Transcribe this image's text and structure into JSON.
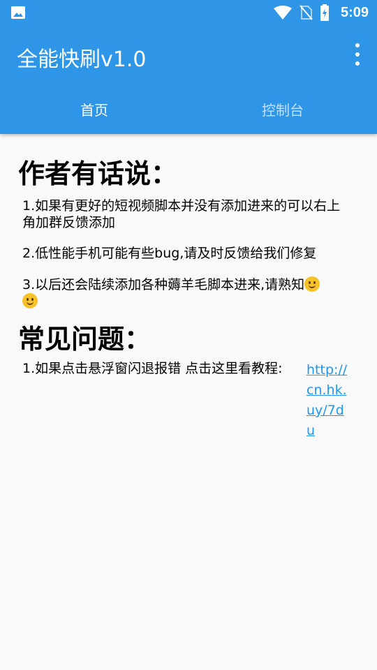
{
  "status_bar": {
    "time": "5:09",
    "left_icon": "image-icon",
    "right_icons": [
      "wifi-icon",
      "no-sim-icon",
      "battery-charging-icon"
    ]
  },
  "toolbar": {
    "title": "全能快刷v1.0",
    "overflow_icon": "more-vert-icon"
  },
  "tabs": [
    {
      "label": "首页",
      "active": true
    },
    {
      "label": "控制台",
      "active": false
    }
  ],
  "home": {
    "author_heading": "作者有话说：",
    "notes": [
      "1.如果有更好的短视频脚本并没有添加进来的可以右上角加群反馈添加",
      "2.低性能手机可能有些bug,请及时反馈给我们修复",
      "3.以后还会陆续添加各种薅羊毛脚本进来,请熟知"
    ],
    "faq_heading": "常见问题：",
    "faq": [
      {
        "text": "1.如果点击悬浮窗闪退报错 点击这里看教程:",
        "link": "http://cn.hk.uy/7du"
      }
    ]
  },
  "colors": {
    "primary": "#2f95e6",
    "link": "#2196f3",
    "background": "#f9f9f9"
  }
}
